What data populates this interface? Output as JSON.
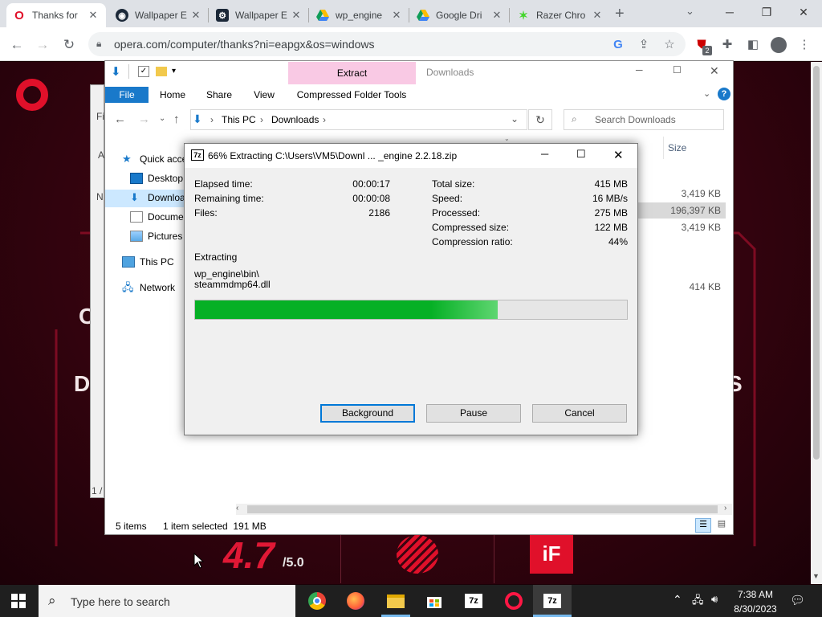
{
  "browser": {
    "tabs": [
      {
        "label": "Thanks for",
        "icon": "opera-icon",
        "active": true
      },
      {
        "label": "Wallpaper E",
        "icon": "steam-icon"
      },
      {
        "label": "Wallpaper E",
        "icon": "steam-icon"
      },
      {
        "label": "wp_engine",
        "icon": "drive-icon"
      },
      {
        "label": "Google Dri",
        "icon": "drive-icon"
      },
      {
        "label": "Razer Chro",
        "icon": "razer-icon"
      }
    ],
    "url": "opera.com/computer/thanks?ni=eapgx&os=windows",
    "extension_badge": "2"
  },
  "page": {
    "rating_value": "4.7",
    "rating_scale": "/5.0",
    "partial_left_a": "C",
    "partial_left_b": "D",
    "partial_right": "S"
  },
  "explorer": {
    "ribbon_context": "Extract",
    "title": "Downloads",
    "ribbon_tabs": [
      "File",
      "Home",
      "Share",
      "View",
      "Compressed Folder Tools"
    ],
    "breadcrumb": [
      "This PC",
      "Downloads"
    ],
    "search_placeholder": "Search Downloads",
    "column_size": "Size",
    "nav": [
      {
        "label": "Quick acce",
        "icon": "star-icon"
      },
      {
        "label": "Desktop",
        "icon": "desktop-icon"
      },
      {
        "label": "Downloa",
        "icon": "download-icon",
        "selected": true
      },
      {
        "label": "Docume",
        "icon": "document-icon"
      },
      {
        "label": "Pictures",
        "icon": "pictures-icon"
      },
      {
        "label": "This PC",
        "icon": "pc-icon"
      },
      {
        "label": "Network",
        "icon": "network-icon"
      }
    ],
    "sizes": [
      "3,419 KB",
      "196,397 KB",
      "3,419 KB",
      "414 KB"
    ],
    "status_items": "5 items",
    "status_selected": "1 item selected  191 MB"
  },
  "back_window": {
    "labels": [
      "Fi",
      "A",
      "N",
      "1 /"
    ]
  },
  "dialog": {
    "title": "66% Extracting C:\\Users\\VM5\\Downl ... _engine 2.2.18.zip",
    "left_stats": [
      {
        "label": "Elapsed time:",
        "value": "00:00:17"
      },
      {
        "label": "Remaining time:",
        "value": "00:00:08"
      },
      {
        "label": "Files:",
        "value": "2186"
      }
    ],
    "right_stats": [
      {
        "label": "Total size:",
        "value": "415 MB"
      },
      {
        "label": "Speed:",
        "value": "16 MB/s"
      },
      {
        "label": "Processed:",
        "value": "275 MB"
      },
      {
        "label": "Compressed size:",
        "value": "122 MB"
      },
      {
        "label": "Compression ratio:",
        "value": "44%"
      }
    ],
    "action": "Extracting",
    "path_line1": "wp_engine\\bin\\",
    "path_line2": "steammdmp64.dll",
    "progress": 0.7,
    "buttons": {
      "background": "Background",
      "pause": "Pause",
      "cancel": "Cancel"
    }
  },
  "taskbar": {
    "search_placeholder": "Type here to search",
    "time": "7:38 AM",
    "date": "8/30/2023"
  },
  "colors": {
    "accent": "#0078d7",
    "progress": "#06b025",
    "opera_red": "#e0102a"
  }
}
